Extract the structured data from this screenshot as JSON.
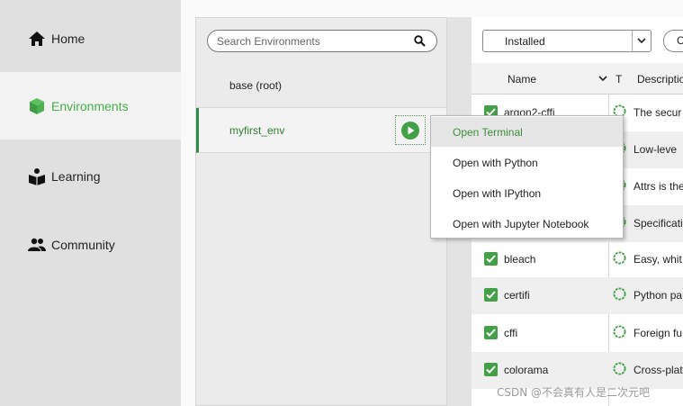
{
  "nav": {
    "items": [
      {
        "label": "Home",
        "icon": "home-icon"
      },
      {
        "label": "Environments",
        "icon": "cube-icon",
        "active": true
      },
      {
        "label": "Learning",
        "icon": "learning-icon"
      },
      {
        "label": "Community",
        "icon": "people-icon"
      }
    ]
  },
  "environments": {
    "search_placeholder": "Search Environments",
    "items": [
      {
        "name": "base (root)"
      },
      {
        "name": "myfirst_env",
        "selected": true
      }
    ]
  },
  "packages": {
    "filter_value": "Installed",
    "update_button": "C",
    "columns": {
      "name": "Name",
      "type": "T",
      "description": "Descriptio"
    },
    "rows": [
      {
        "name": "argon2-cffi",
        "description": "The secur"
      },
      {
        "name": "",
        "description": "Low-leve"
      },
      {
        "name": "",
        "description": "Attrs is the"
      },
      {
        "name": "",
        "description": "Specificatio"
      },
      {
        "name": "bleach",
        "description": "Easy, whit"
      },
      {
        "name": "certifi",
        "description": "Python pa"
      },
      {
        "name": "cffi",
        "description": "Foreign fu"
      },
      {
        "name": "colorama",
        "description": "Cross-plat"
      }
    ]
  },
  "context_menu": {
    "items": [
      {
        "label": "Open Terminal",
        "hover": true
      },
      {
        "label": "Open with Python"
      },
      {
        "label": "Open with IPython"
      },
      {
        "label": "Open with Jupyter Notebook"
      }
    ]
  },
  "watermark": "CSDN @不会真有人是二次元吧",
  "colors": {
    "accent": "#43b049",
    "selected_text": "#2e7d32",
    "play": "#43a047"
  }
}
